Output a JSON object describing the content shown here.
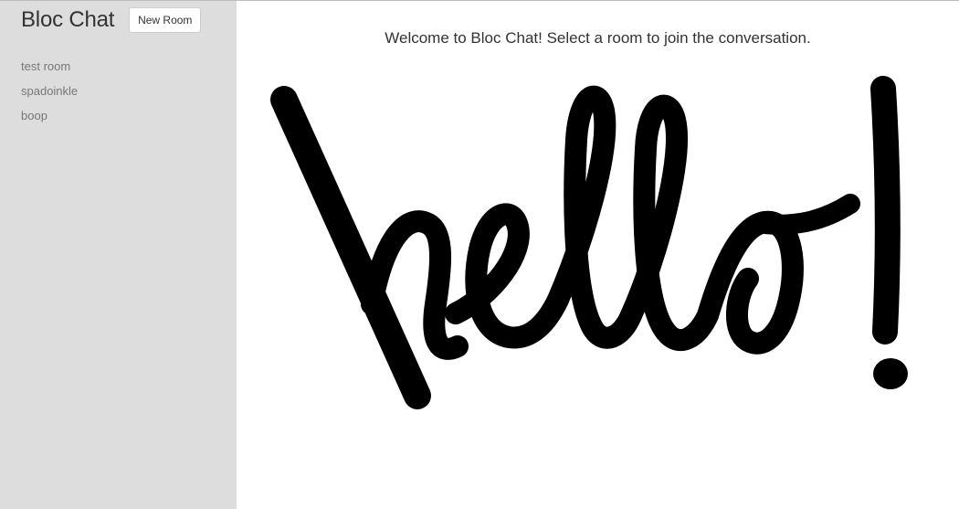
{
  "sidebar": {
    "title": "Bloc Chat",
    "new_room_label": "New Room",
    "rooms": [
      {
        "label": "test room"
      },
      {
        "label": "spadoinkle"
      },
      {
        "label": "boop"
      }
    ]
  },
  "main": {
    "welcome_text": "Welcome to Bloc Chat! Select a room to join the conversation.",
    "hero_image": {
      "text": "hello!",
      "color": "#000000"
    }
  },
  "colors": {
    "sidebar_bg": "#dddddd",
    "main_bg": "#ffffff",
    "room_text": "#777777",
    "title_text": "#333333"
  }
}
